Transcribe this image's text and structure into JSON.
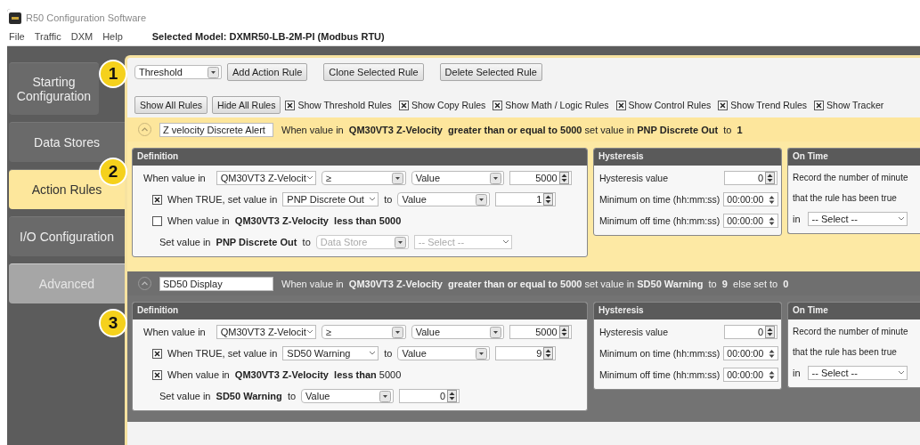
{
  "window": {
    "title": "R50 Configuration Software"
  },
  "menu": [
    "File",
    "Traffic",
    "DXM",
    "Help"
  ],
  "selected_model": "Selected Model:  DXMR50-LB-2M-PI (Modbus RTU)",
  "sidebar": {
    "items": [
      {
        "label": "Starting Configuration",
        "selected": false,
        "disabled": false
      },
      {
        "label": "Data Stores",
        "selected": false,
        "disabled": false
      },
      {
        "label": "Action Rules",
        "selected": true,
        "disabled": false
      },
      {
        "label": "I/O Configuration",
        "selected": false,
        "disabled": false
      },
      {
        "label": "Advanced",
        "selected": false,
        "disabled": true
      }
    ]
  },
  "callouts": [
    "1",
    "2",
    "3"
  ],
  "toolbar": {
    "rule_type": "Threshold",
    "buttons": [
      "Add Action Rule",
      "Clone Selected Rule",
      "Delete Selected Rule"
    ],
    "view_buttons": [
      "Show All Rules",
      "Hide All Rules"
    ],
    "filters": [
      {
        "label": "Show Threshold Rules",
        "checked": true
      },
      {
        "label": "Show Copy Rules",
        "checked": true
      },
      {
        "label": "Show Math / Logic Rules",
        "checked": true
      },
      {
        "label": "Show Control Rules",
        "checked": true
      },
      {
        "label": "Show Trend Rules",
        "checked": true
      },
      {
        "label": "Show Tracker",
        "checked": true
      }
    ]
  },
  "rules": [
    {
      "selected": true,
      "name": "Z velocity Discrete Alert",
      "summary": "When value in  **QM30VT3 Z-Velocity**  **greater than or equal to 5000** set value in **PNP Discrete Out**  to  **1**",
      "definition": {
        "title": "Definition",
        "source_label": "When value in",
        "source": "QM30VT3 Z-Velocit",
        "operator": "≥",
        "compare_type": "Value",
        "compare_value": "5000",
        "true_checked": true,
        "true_label": "When TRUE, set value in",
        "true_target": "PNP Discrete Out",
        "true_to": "to",
        "true_type": "Value",
        "true_value": "1",
        "else_checked": false,
        "else_condition": "When value in  **QM30VT3 Z-Velocity**  **less than 5000**",
        "else_set": "Set value in  **PNP Discrete Out**  to",
        "else_fields": [
          {
            "kind": "dropdown",
            "value": "Data Store",
            "disabled": true
          },
          {
            "kind": "combo",
            "value": "-- Select --",
            "disabled": true
          }
        ]
      },
      "hysteresis": {
        "title": "Hysteresis",
        "rows": [
          {
            "label": "Hysteresis value",
            "kind": "number",
            "value": "0"
          },
          {
            "label": "Minimum on time (hh:mm:ss)",
            "kind": "time",
            "value": "00:00:00"
          },
          {
            "label": "Minimum off time (hh:mm:ss)",
            "kind": "time",
            "value": "00:00:00"
          }
        ]
      },
      "on_time": {
        "title": "On Time",
        "lines": [
          "Record the number of minute",
          "that the rule has been true"
        ],
        "in_label": "in",
        "select": "-- Select --"
      }
    },
    {
      "selected": false,
      "name": "SD50 Display",
      "summary": "When value in  **QM30VT3 Z-Velocity**  **greater than or equal to 5000** set value in **SD50 Warning**  to  **9**  else set to  **0**",
      "definition": {
        "title": "Definition",
        "source_label": "When value in",
        "source": "QM30VT3 Z-Velocit",
        "operator": "≥",
        "compare_type": "Value",
        "compare_value": "5000",
        "true_checked": true,
        "true_label": "When TRUE, set value in",
        "true_target": "SD50 Warning",
        "true_to": "to",
        "true_type": "Value",
        "true_value": "9",
        "else_checked": true,
        "else_condition": "When value in  **QM30VT3 Z-Velocity**  **less than** 5000",
        "else_set": "Set value in  **SD50 Warning**  to",
        "else_fields": [
          {
            "kind": "dropdown",
            "value": "Value",
            "disabled": false
          },
          {
            "kind": "number",
            "value": "0",
            "disabled": false
          }
        ]
      },
      "hysteresis": {
        "title": "Hysteresis",
        "rows": [
          {
            "label": "Hysteresis value",
            "kind": "number",
            "value": "0"
          },
          {
            "label": "Minimum on time (hh:mm:ss)",
            "kind": "time",
            "value": "00:00:00"
          },
          {
            "label": "Minimum off time (hh:mm:ss)",
            "kind": "time",
            "value": "00:00:00"
          }
        ]
      },
      "on_time": {
        "title": "On Time",
        "lines": [
          "Record the number of minute",
          "that the rule has been true"
        ],
        "in_label": "in",
        "select": "-- Select --"
      }
    }
  ]
}
